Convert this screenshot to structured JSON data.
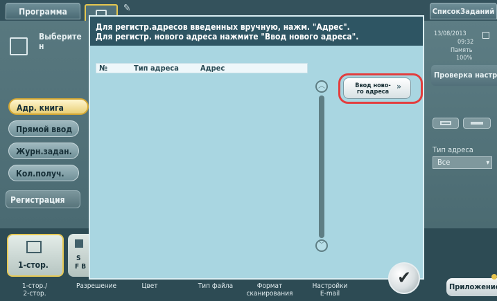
{
  "top": {
    "program_label": "Программа",
    "job_list_label": "СписокЗаданий"
  },
  "left": {
    "select_hint": "Выберите н",
    "buttons": [
      "Адр. книга",
      "Прямой ввод",
      "Журн.задан.",
      "Кол.получ."
    ],
    "register_label": "Регистрация"
  },
  "right": {
    "date": "13/08/2013",
    "time": "09:32",
    "memory_label": "Память",
    "memory_value": "100%",
    "check_settings_label": "Проверка настро",
    "address_type_label": "Тип адреса",
    "address_type_value": "Все"
  },
  "dialog": {
    "message_line1": "Для регистр.адресов введенных вручную, нажм. \"Адрес\".",
    "message_line2": "Для регистр. нового адреса нажмите \"Ввод нового адреса\".",
    "table_headers": [
      "№",
      "Тип адреса",
      "Адрес"
    ],
    "new_address_line1": "Ввод ново-",
    "new_address_line2": "го адреса",
    "ok_symbol": "✔"
  },
  "bottom": {
    "duplex_label": "1-стор.",
    "partial_line1": "S",
    "partial_line2": "F B",
    "tabs": [
      {
        "line1": "1-стор./",
        "line2": "2-стор."
      },
      {
        "line1": "Разрешение",
        "line2": ""
      },
      {
        "line1": "Цвет",
        "line2": ""
      },
      {
        "line1": "Тип файла",
        "line2": ""
      },
      {
        "line1": "Формат",
        "line2": "сканирования"
      },
      {
        "line1": "Настройки",
        "line2": "E-mail"
      }
    ],
    "apps_label": "Приложение"
  },
  "colors": {
    "dialog_bg": "#a9d6e1",
    "message_bg": "#2e5563",
    "highlight": "#e33e3e",
    "active_button": "#e9cf77"
  }
}
